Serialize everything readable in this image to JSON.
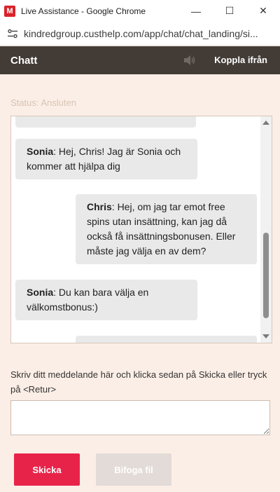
{
  "window": {
    "title": "Live Assistance - Google Chrome",
    "app_icon_letter": "M",
    "minimize": "—",
    "maximize": "☐",
    "close": "✕"
  },
  "address_bar": {
    "url": "kindredgroup.custhelp.com/app/chat/chat_landing/si..."
  },
  "chat_header": {
    "title": "Chatt",
    "disconnect_label": "Koppla ifrån"
  },
  "status": "Status: Ansluten",
  "transcript": {
    "messages": [
      {
        "author": "Sonia",
        "text": ": Hej, Chris! Jag är Sonia och kommer att hjälpa dig"
      },
      {
        "author": "Chris",
        "text": ": Hej, om jag tar emot free spins utan insättning, kan jag då också få insättningsbonusen. Eller måste jag välja en av dem?"
      },
      {
        "author": "Sonia",
        "text": ": Du kan bara välja en välkomstbonus:)"
      }
    ]
  },
  "prompt": "Skriv ditt meddelande här och klicka sedan på Skicka eller tryck på <Retur>",
  "buttons": {
    "send": "Skicka",
    "attach": "Bifoga fil"
  },
  "colors": {
    "header_bg": "#423b36",
    "page_bg": "#fbeee6",
    "send_bg": "#e8234a",
    "attach_bg": "#e3dbd7"
  }
}
